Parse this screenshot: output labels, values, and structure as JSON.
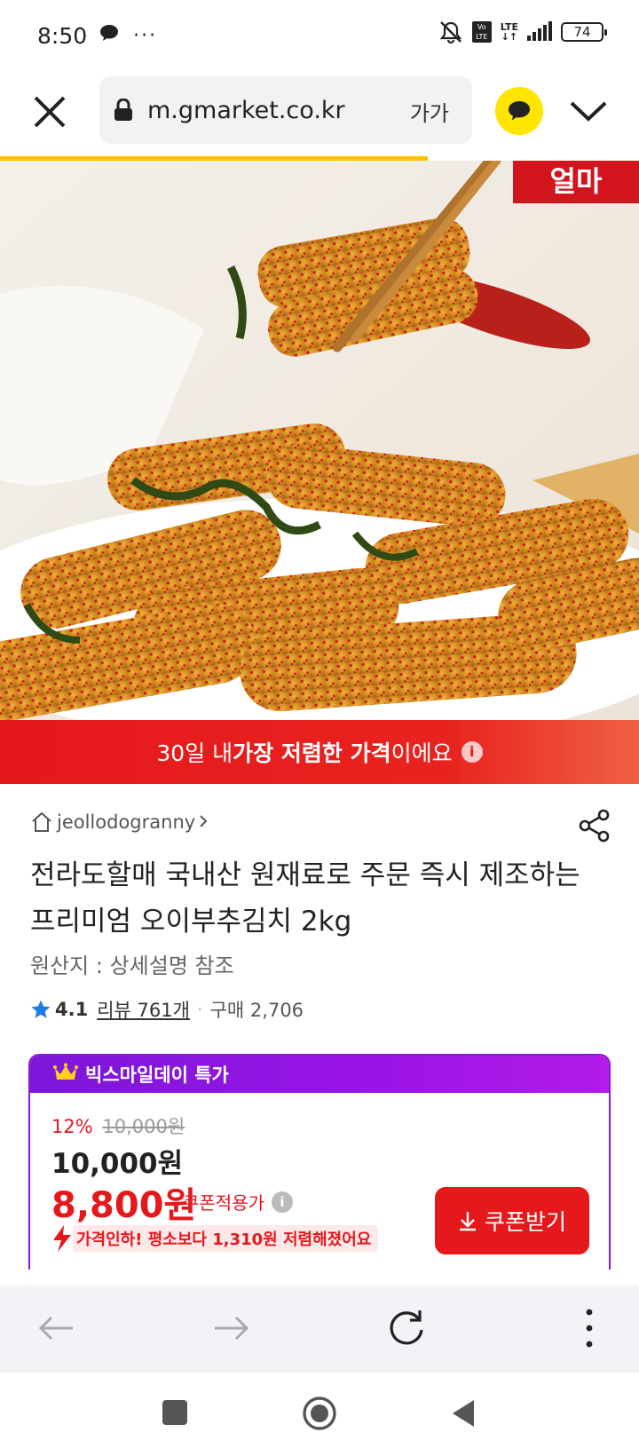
{
  "status_bar": {
    "time": "8:50",
    "more": "···",
    "network_volte": "Vo LTE",
    "network": "LTE",
    "battery": "74"
  },
  "browser": {
    "url": "m.gmarket.co.kr",
    "reader_mode": "가가",
    "page_load_progress": 0.67,
    "accent_color": "#ffc000"
  },
  "hero": {
    "badge_text": "얼마"
  },
  "deal_banner": {
    "prefix": "30일 내 ",
    "bold": "가장 저렴한 가격",
    "suffix": "이에요",
    "info_icon": "i"
  },
  "product": {
    "seller": "jeollodogranny",
    "title": "전라도할매 국내산 원재료로 주문 즉시 제조하는 프리미엄 오이부추김치 2kg",
    "origin": "원산지 : 상세설명 참조",
    "rating": "4.1",
    "reviews": "리뷰 761개",
    "purchases": "구매 2,706"
  },
  "promo": {
    "label": "빅스마일데이 특가",
    "discount_rate": "12%",
    "original_price": "10,000원",
    "price": "10,000원",
    "sale_price": "8,800원",
    "coupon_applied": "쿠폰적용가",
    "info_icon": "i",
    "price_drop": "가격인하! 평소보다 1,310원 저렴해졌어요",
    "coupon_button": "쿠폰받기",
    "colors": {
      "purple": "#8a18d8",
      "red": "#e5181c"
    }
  },
  "browser_nav": {
    "back": "back-icon",
    "forward": "forward-icon",
    "reload": "reload-icon",
    "menu": "more-vertical-icon"
  }
}
